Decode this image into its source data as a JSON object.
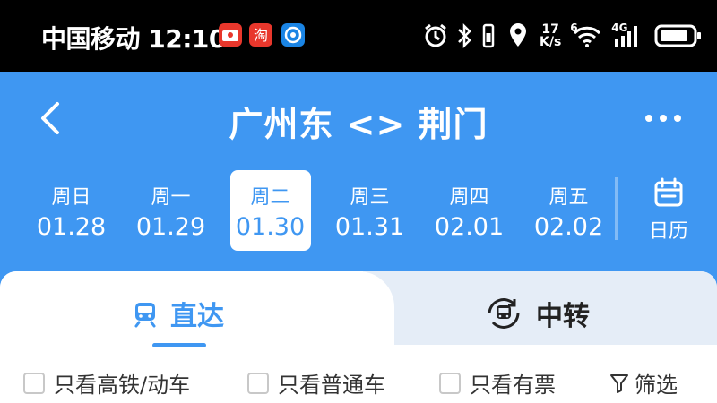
{
  "status_bar": {
    "carrier": "中国移动",
    "time": "12:10",
    "net_speed_value": "17",
    "net_speed_unit": "K/s",
    "wifi_label": "6",
    "cell_label": "4G",
    "icons": [
      "red-envelope-icon",
      "taobao-icon",
      "browser-icon",
      "alarm-icon",
      "bluetooth-icon",
      "vibrate-icon",
      "location-icon",
      "wifi-icon",
      "signal-icon",
      "battery-icon"
    ]
  },
  "header": {
    "title": "广州东 <> 荆门",
    "back_icon": "chevron-left-icon",
    "more_icon": "more-dots-icon"
  },
  "dates": [
    {
      "weekday": "周日",
      "date": "01.28"
    },
    {
      "weekday": "周一",
      "date": "01.29"
    },
    {
      "weekday": "周二",
      "date": "01.30",
      "active": true
    },
    {
      "weekday": "周三",
      "date": "01.31"
    },
    {
      "weekday": "周四",
      "date": "02.01"
    },
    {
      "weekday": "周五",
      "date": "02.02"
    }
  ],
  "calendar": {
    "label": "日历"
  },
  "tabs": [
    {
      "label": "直达",
      "active": true
    },
    {
      "label": "中转",
      "active": false
    }
  ],
  "filters": {
    "high_speed_only": "只看高铁/动车",
    "normal_only": "只看普通车",
    "available_only": "只看有票",
    "filter_label": "筛选"
  },
  "colors": {
    "primary": "#3f97f2",
    "tab_inactive_bg": "#e5edf7"
  }
}
